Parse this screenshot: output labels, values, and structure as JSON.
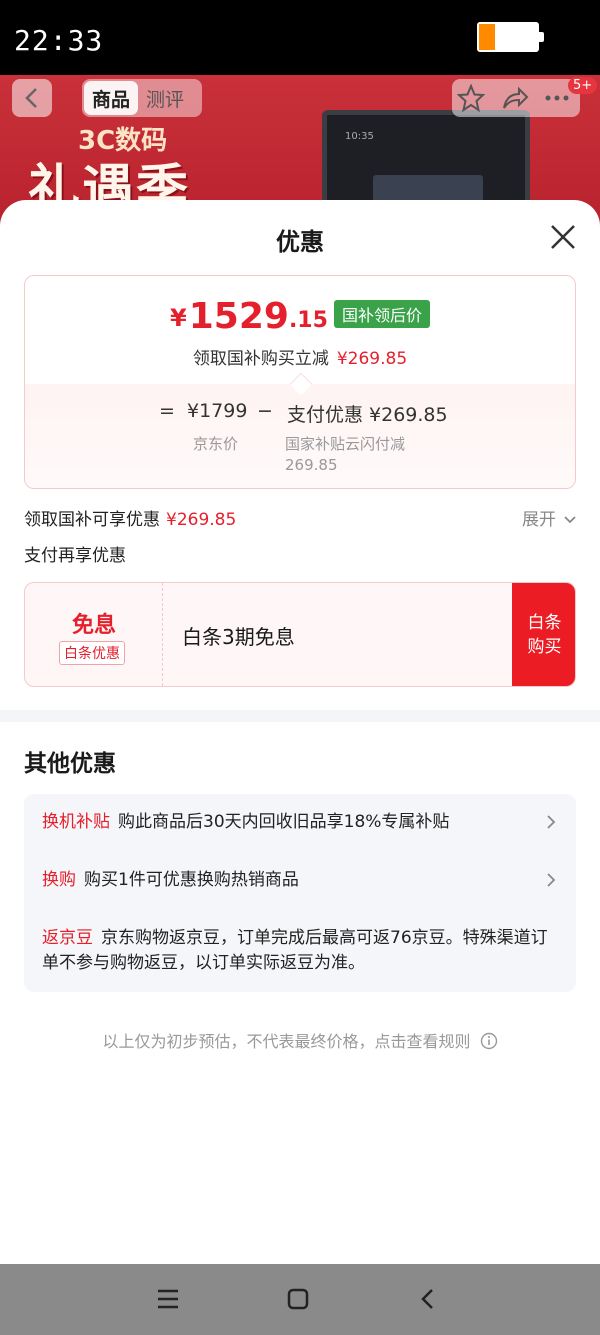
{
  "status_bar": {
    "time": "22:33",
    "battery_level": 0.28
  },
  "product_header": {
    "tabs": [
      {
        "label": "商品"
      },
      {
        "label": "测评"
      }
    ],
    "banner_top": "3C数码",
    "banner_main": "礼遇季",
    "tablet_time": "10:35",
    "badge": "5+"
  },
  "sheet": {
    "title": "优惠",
    "price_card": {
      "yen": "¥",
      "price_int": "1529",
      "price_dec": ".15",
      "tag": "国补领后价",
      "subtitle": "领取国补购买立减",
      "subtitle_amount": "¥269.85",
      "equation": {
        "eq": "=",
        "jd_price": "¥1799",
        "minus": "−",
        "pay_discount": "支付优惠 ¥269.85",
        "jd_price_label": "京东价",
        "pay_discount_label_1": "国家补贴云闪付减",
        "pay_discount_label_2": "269.85"
      }
    },
    "subsidy_row": {
      "label": "领取国补可享优惠",
      "amount": "¥269.85"
    },
    "expand_label": "展开",
    "pay_more_label": "支付再享优惠",
    "baitiao": {
      "free_label": "免息",
      "tag": "白条优惠",
      "desc": "白条3期免息",
      "buy_line1": "白条",
      "buy_line2": "购买"
    },
    "other_title": "其他优惠",
    "offers": [
      {
        "label": "换机补贴",
        "text": "购此商品后30天内回收旧品享18%专属补贴"
      },
      {
        "label": "换购",
        "text": "购买1件可优惠换购热销商品"
      },
      {
        "label": "返京豆",
        "text": "京东购物返京豆，订单完成后最高可返76京豆。特殊渠道订单不参与购物返豆，以订单实际返豆为准。"
      }
    ],
    "footnote": "以上仅为初步预估，不代表最终价格，点击查看规则"
  },
  "colors": {
    "accent_red": "#e5202d",
    "tag_green": "#3aa34a",
    "buy_red": "#ec1c24"
  }
}
